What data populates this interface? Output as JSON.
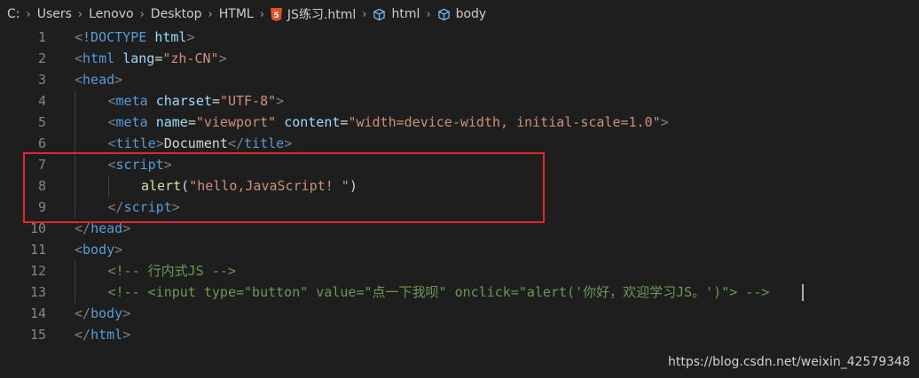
{
  "breadcrumb": {
    "items": [
      {
        "label": "C:",
        "icon": null
      },
      {
        "label": "Users",
        "icon": null
      },
      {
        "label": "Lenovo",
        "icon": null
      },
      {
        "label": "Desktop",
        "icon": null
      },
      {
        "label": "HTML",
        "icon": null
      },
      {
        "label": "JS练习.html",
        "icon": "html5-icon"
      },
      {
        "label": "html",
        "icon": "cube-icon"
      },
      {
        "label": "body",
        "icon": "cube-icon"
      }
    ],
    "separator": "›"
  },
  "editor": {
    "lines": [
      {
        "num": "1",
        "indent": 0,
        "tokens": [
          [
            "br",
            "<"
          ],
          [
            "tag",
            "!DOCTYPE"
          ],
          [
            "text",
            " "
          ],
          [
            "attr",
            "html"
          ],
          [
            "br",
            ">"
          ]
        ]
      },
      {
        "num": "2",
        "indent": 0,
        "tokens": [
          [
            "br",
            "<"
          ],
          [
            "tag",
            "html"
          ],
          [
            "text",
            " "
          ],
          [
            "attr",
            "lang"
          ],
          [
            "text",
            "="
          ],
          [
            "str",
            "\"zh-CN\""
          ],
          [
            "br",
            ">"
          ]
        ]
      },
      {
        "num": "3",
        "indent": 0,
        "tokens": [
          [
            "br",
            "<"
          ],
          [
            "tag",
            "head"
          ],
          [
            "br",
            ">"
          ]
        ]
      },
      {
        "num": "4",
        "indent": 1,
        "tokens": [
          [
            "br",
            "<"
          ],
          [
            "tag",
            "meta"
          ],
          [
            "text",
            " "
          ],
          [
            "attr",
            "charset"
          ],
          [
            "text",
            "="
          ],
          [
            "str",
            "\"UTF-8\""
          ],
          [
            "br",
            ">"
          ]
        ]
      },
      {
        "num": "5",
        "indent": 1,
        "tokens": [
          [
            "br",
            "<"
          ],
          [
            "tag",
            "meta"
          ],
          [
            "text",
            " "
          ],
          [
            "attr",
            "name"
          ],
          [
            "text",
            "="
          ],
          [
            "str",
            "\"viewport\""
          ],
          [
            "text",
            " "
          ],
          [
            "attr",
            "content"
          ],
          [
            "text",
            "="
          ],
          [
            "str",
            "\"width=device-width, initial-scale=1.0\""
          ],
          [
            "br",
            ">"
          ]
        ]
      },
      {
        "num": "6",
        "indent": 1,
        "tokens": [
          [
            "br",
            "<"
          ],
          [
            "tag",
            "title"
          ],
          [
            "br",
            ">"
          ],
          [
            "text",
            "Document"
          ],
          [
            "br",
            "</"
          ],
          [
            "tag",
            "title"
          ],
          [
            "br",
            ">"
          ]
        ]
      },
      {
        "num": "7",
        "indent": 1,
        "tokens": [
          [
            "br",
            "<"
          ],
          [
            "tag",
            "script"
          ],
          [
            "br",
            ">"
          ]
        ]
      },
      {
        "num": "8",
        "indent": 2,
        "tokens": [
          [
            "fn",
            "alert"
          ],
          [
            "text",
            "("
          ],
          [
            "str",
            "\"hello,JavaScript! \""
          ],
          [
            "text",
            ")"
          ]
        ]
      },
      {
        "num": "9",
        "indent": 1,
        "tokens": [
          [
            "br",
            "</"
          ],
          [
            "tag",
            "script"
          ],
          [
            "br",
            ">"
          ]
        ]
      },
      {
        "num": "10",
        "indent": 0,
        "tokens": [
          [
            "br",
            "</"
          ],
          [
            "tag",
            "head"
          ],
          [
            "br",
            ">"
          ]
        ]
      },
      {
        "num": "11",
        "indent": 0,
        "tokens": [
          [
            "br",
            "<"
          ],
          [
            "tag",
            "body"
          ],
          [
            "br",
            ">"
          ]
        ]
      },
      {
        "num": "12",
        "indent": 1,
        "tokens": [
          [
            "com",
            "<!-- 行内式JS -->"
          ]
        ]
      },
      {
        "num": "13",
        "indent": 1,
        "tokens": [
          [
            "com",
            "<!-- <input type=\"button\" value=\"点一下我呗\" onclick=\"alert('你好，欢迎学习JS。')\"> -->"
          ]
        ]
      },
      {
        "num": "14",
        "indent": 0,
        "tokens": [
          [
            "br",
            "</"
          ],
          [
            "tag",
            "body"
          ],
          [
            "br",
            ">"
          ]
        ]
      },
      {
        "num": "15",
        "indent": 0,
        "tokens": [
          [
            "br",
            "</"
          ],
          [
            "tag",
            "html"
          ],
          [
            "br",
            ">"
          ]
        ]
      }
    ]
  },
  "colors": {
    "background": "#1e1e1e",
    "tag": "#569cd6",
    "bracket": "#808080",
    "attribute": "#9cdcfe",
    "string": "#ce9178",
    "function": "#dcdcaa",
    "comment": "#6a9955",
    "line_number": "#858585",
    "highlight_box": "#e2262b"
  },
  "watermark": "https://blog.csdn.net/weixin_42579348"
}
